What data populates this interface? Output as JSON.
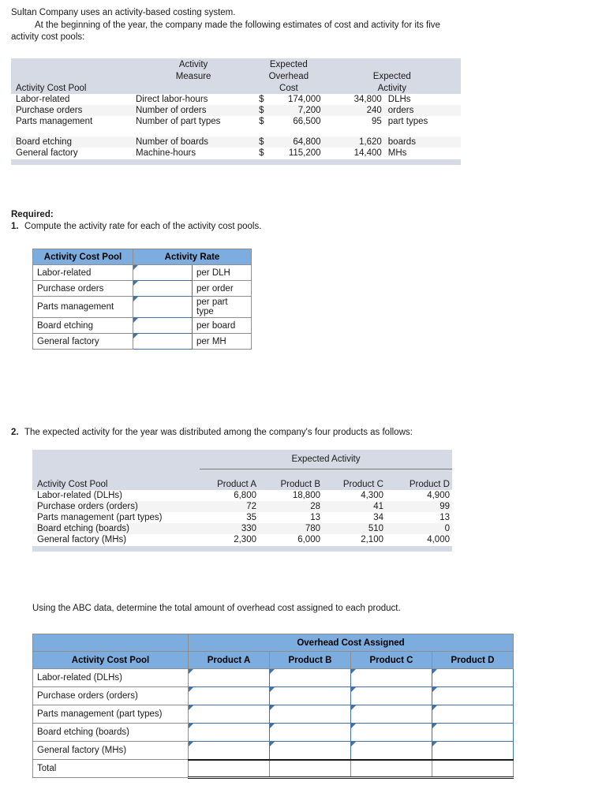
{
  "intro": {
    "line1": "Sultan Company uses an activity-based costing system.",
    "line2": "At the beginning of the year, the company made the following estimates of cost and activity for its five",
    "line3": "activity cost pools:"
  },
  "estimates_table": {
    "headers": {
      "pool": "Activity Cost Pool",
      "measure_l1": "Activity",
      "measure_l2": "Measure",
      "overhead_l1": "Expected",
      "overhead_l2": "Overhead",
      "overhead_l3": "Cost",
      "activity_l1": "Expected",
      "activity_l2": "Activity"
    },
    "rows": [
      {
        "pool": "Labor-related",
        "measure": "Direct labor-hours",
        "currency": "$",
        "cost": "174,000",
        "activity": "34,800",
        "unit": "DLHs"
      },
      {
        "pool": "Purchase orders",
        "measure": "Number of orders",
        "currency": "$",
        "cost": "7,200",
        "activity": "240",
        "unit": "orders"
      },
      {
        "pool": "Parts management",
        "measure": "Number of part types",
        "currency": "$",
        "cost": "66,500",
        "activity": "95",
        "unit": "part types"
      },
      {
        "pool": "Board etching",
        "measure": "Number of boards",
        "currency": "$",
        "cost": "64,800",
        "activity": "1,620",
        "unit": "boards"
      },
      {
        "pool": "General factory",
        "measure": "Machine-hours",
        "currency": "$",
        "cost": "115,200",
        "activity": "14,400",
        "unit": "MHs"
      }
    ]
  },
  "required": {
    "label": "Required:",
    "q1_num": "1.",
    "q1_text": "Compute the activity rate for each of the activity cost pools."
  },
  "activity_rate_table": {
    "headers": {
      "pool": "Activity Cost Pool",
      "rate": "Activity Rate"
    },
    "rows": [
      {
        "pool": "Labor-related",
        "unit": "per DLH"
      },
      {
        "pool": "Purchase orders",
        "unit": "per order"
      },
      {
        "pool": "Parts management",
        "unit_l1": "per part",
        "unit_l2": "type"
      },
      {
        "pool": "Board etching",
        "unit": "per board"
      },
      {
        "pool": "General factory",
        "unit": "per MH"
      }
    ]
  },
  "question2": {
    "num": "2.",
    "text": "The expected activity for the year was distributed among the company's four products as follows:"
  },
  "expected_activity_table": {
    "group_header": "Expected Activity",
    "headers": {
      "pool": "Activity Cost Pool",
      "a": "Product A",
      "b": "Product B",
      "c": "Product C",
      "d": "Product D"
    },
    "rows": [
      {
        "pool": "Labor-related (DLHs)",
        "a": "6,800",
        "b": "18,800",
        "c": "4,300",
        "d": "4,900"
      },
      {
        "pool": "Purchase orders (orders)",
        "a": "72",
        "b": "28",
        "c": "41",
        "d": "99"
      },
      {
        "pool": "Parts management (part types)",
        "a": "35",
        "b": "13",
        "c": "34",
        "d": "13"
      },
      {
        "pool": "Board etching (boards)",
        "a": "330",
        "b": "780",
        "c": "510",
        "d": "0"
      },
      {
        "pool": "General factory (MHs)",
        "a": "2,300",
        "b": "6,000",
        "c": "2,100",
        "d": "4,000"
      }
    ]
  },
  "abc_prompt": "Using the ABC data, determine the total amount of overhead cost assigned to each product.",
  "overhead_table": {
    "group_header": "Overhead Cost Assigned",
    "headers": {
      "pool": "Activity Cost Pool",
      "a": "Product A",
      "b": "Product B",
      "c": "Product C",
      "d": "Product D"
    },
    "rows": [
      {
        "pool": "Labor-related (DLHs)"
      },
      {
        "pool": "Purchase orders (orders)"
      },
      {
        "pool": "Parts management (part types)"
      },
      {
        "pool": "Board etching (boards)"
      },
      {
        "pool": "General factory (MHs)"
      }
    ],
    "total_label": "Total"
  },
  "colors": {
    "grey_header": "#d6dae4",
    "blue_header": "#7cadde",
    "input_border": "#4472a8",
    "row_stripe": "#f4f4f5"
  }
}
